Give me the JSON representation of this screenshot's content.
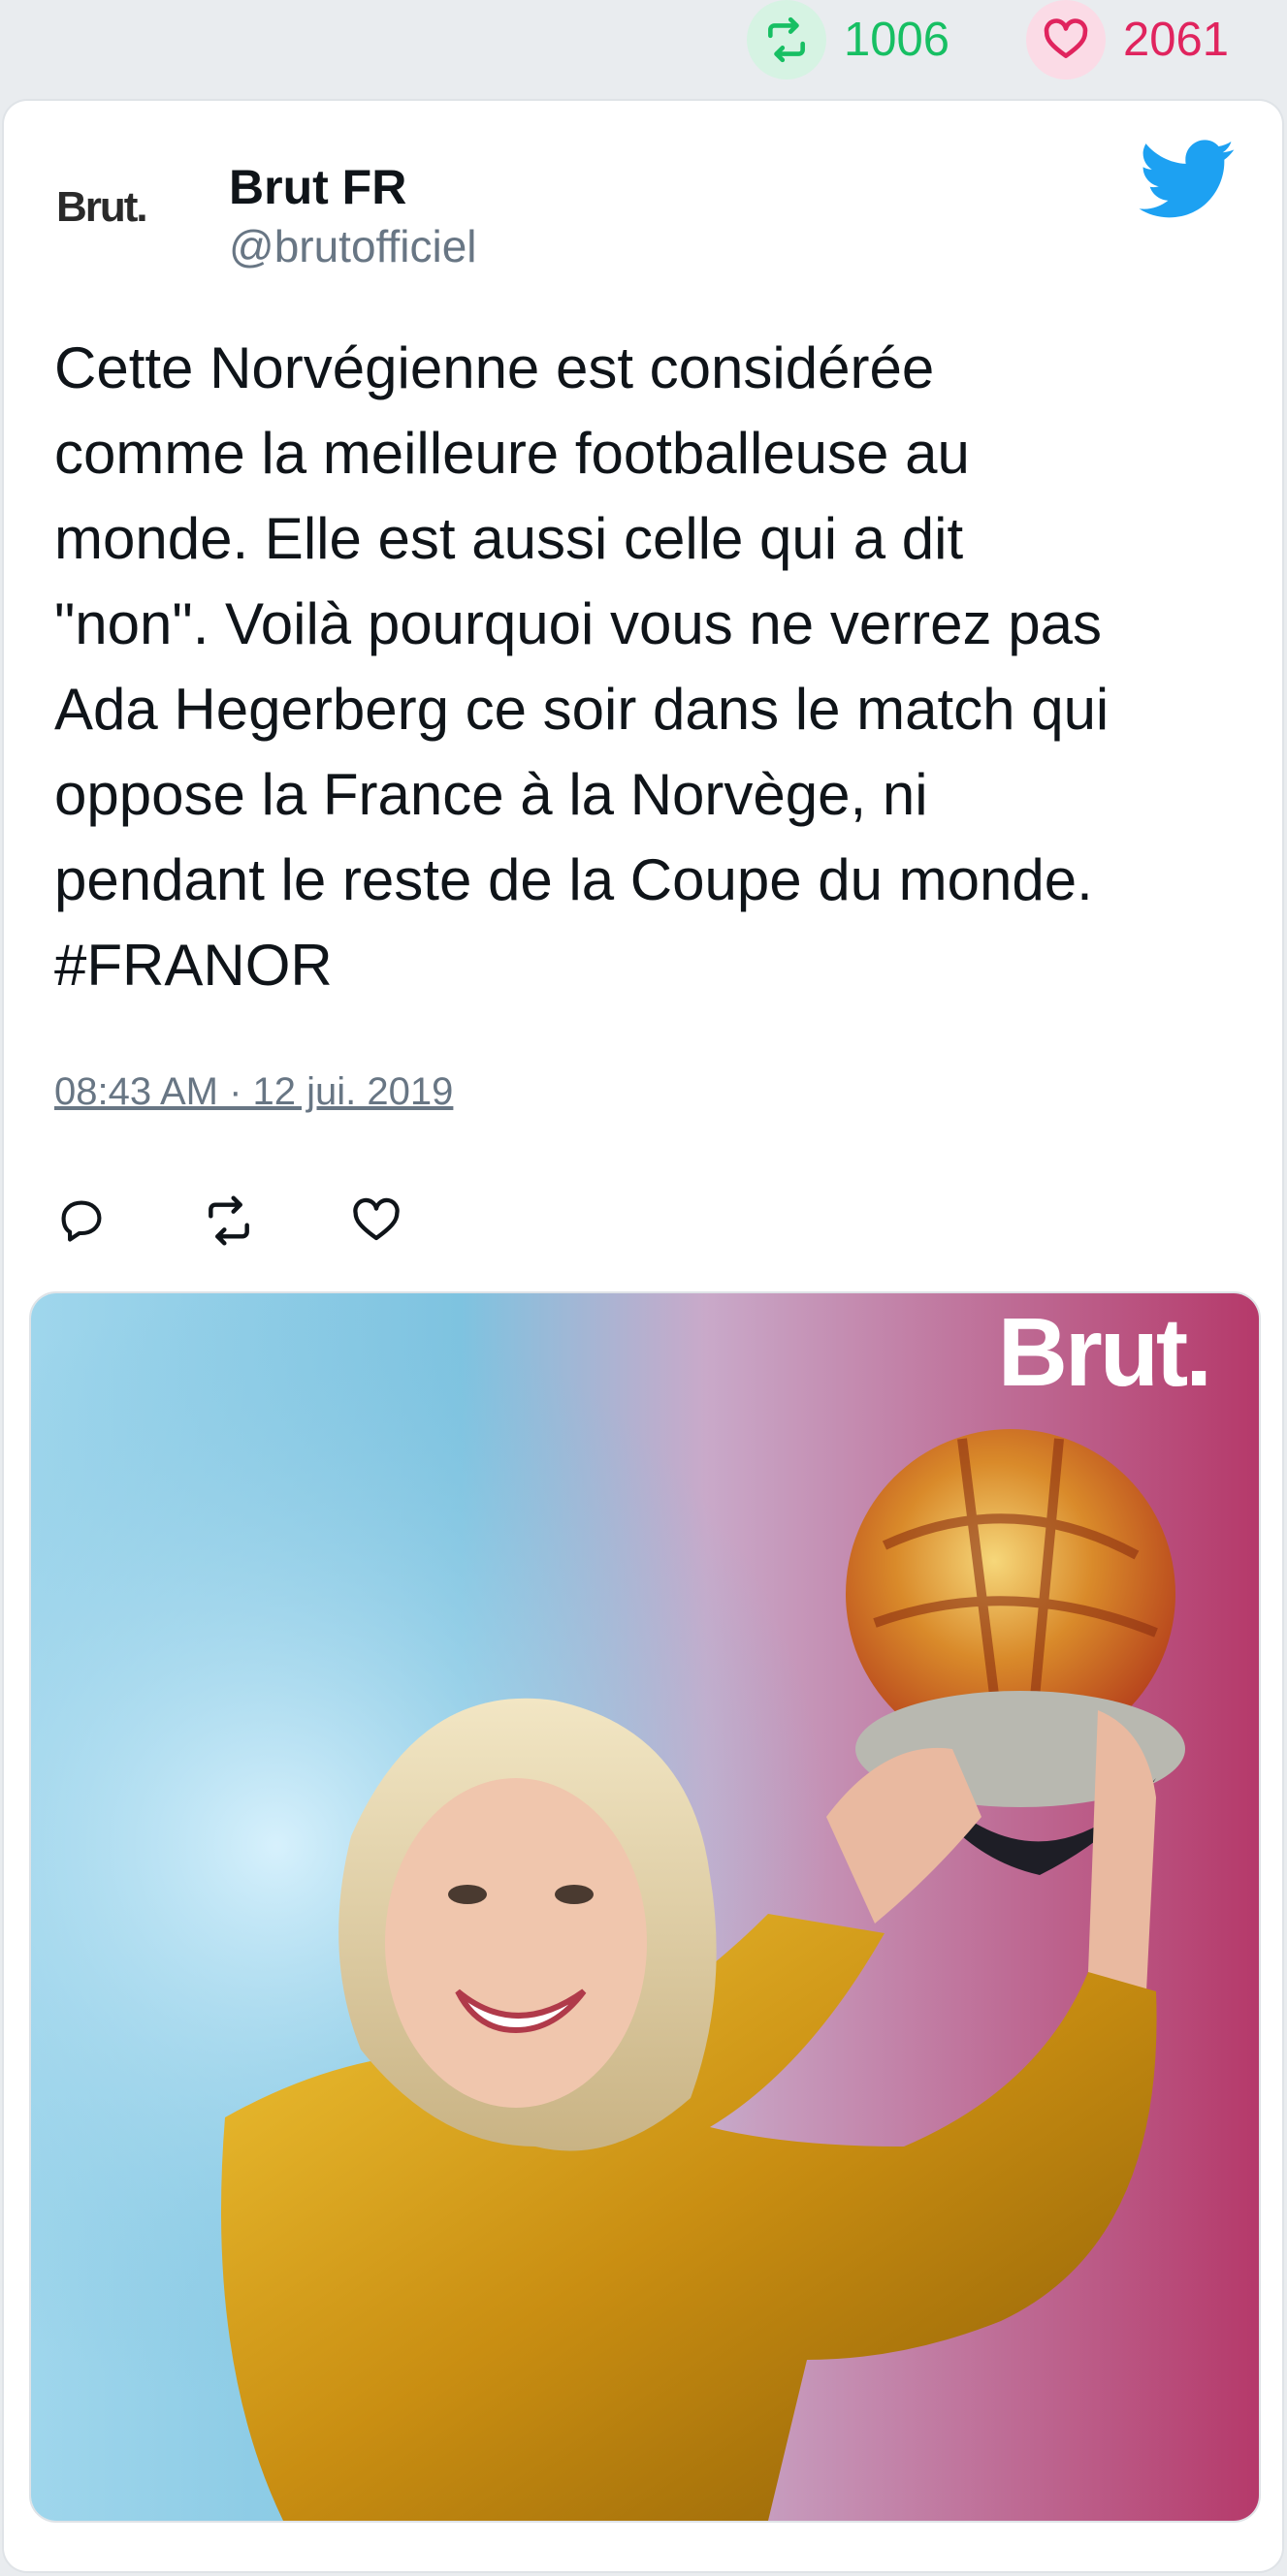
{
  "stats": {
    "retweet_icon": "retweet-icon",
    "retweet_count": "1006",
    "like_icon": "heart-icon",
    "like_count": "2061"
  },
  "tweet": {
    "avatar_text": "Brut.",
    "author_name": "Brut FR",
    "author_handle": "@brutofficiel",
    "text": "Cette Norvégienne est considérée\ncomme la meilleure footballeuse au\nmonde. Elle est aussi celle qui a dit\n\"non\". Voilà pourquoi vous ne verrez pas\nAda Hegerberg ce soir dans le match qui\noppose la France à la Norvège, ni\npendant le reste de la Coupe du monde.\n#FRANOR",
    "timestamp": "08:43 AM · 12 jui. 2019",
    "actions": [
      "reply-icon",
      "retweet-icon",
      "like-icon"
    ]
  },
  "media": {
    "watermark": "Brut.",
    "description_icon": "photo"
  },
  "colors": {
    "retweet": "#17bf63",
    "like": "#e0245e",
    "twitter_blue": "#1da1f2",
    "muted": "#687684"
  }
}
